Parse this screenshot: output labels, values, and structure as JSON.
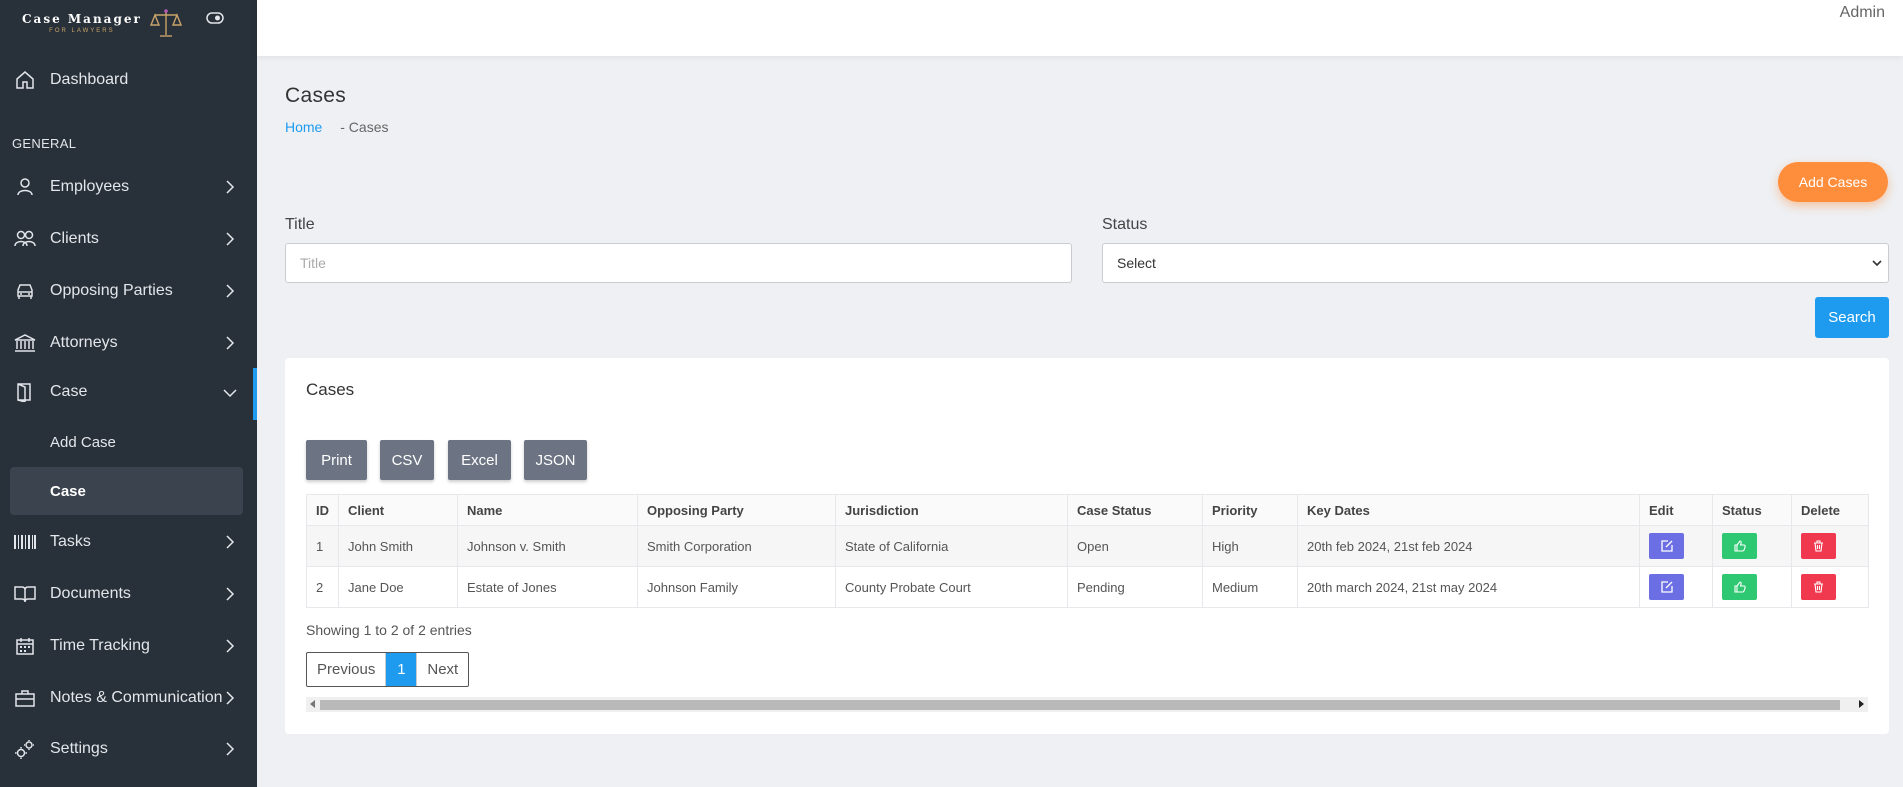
{
  "brand": {
    "title": "Case Manager",
    "subtitle": "FOR LAWYERS"
  },
  "header": {
    "user": "Admin"
  },
  "sidebar": {
    "dashboard": "Dashboard",
    "section": "GENERAL",
    "items": [
      {
        "label": "Employees"
      },
      {
        "label": "Clients"
      },
      {
        "label": "Opposing Parties"
      },
      {
        "label": "Attorneys"
      },
      {
        "label": "Case"
      },
      {
        "label": "Tasks"
      },
      {
        "label": "Documents"
      },
      {
        "label": "Time Tracking"
      },
      {
        "label": "Notes & Communication"
      },
      {
        "label": "Settings"
      }
    ],
    "case_sub": [
      {
        "label": "Add Case"
      },
      {
        "label": "Case"
      }
    ]
  },
  "page": {
    "title": "Cases",
    "breadcrumb_home": "Home",
    "breadcrumb_current": "- Cases",
    "add_button": "Add Cases"
  },
  "filters": {
    "title_label": "Title",
    "title_placeholder": "Title",
    "status_label": "Status",
    "status_value": "Select",
    "search_button": "Search"
  },
  "card": {
    "title": "Cases",
    "export_buttons": [
      "Print",
      "CSV",
      "Excel",
      "JSON"
    ],
    "columns": [
      "ID",
      "Client",
      "Name",
      "Opposing Party",
      "Jurisdiction",
      "Case Status",
      "Priority",
      "Key Dates",
      "Edit",
      "Status",
      "Delete"
    ],
    "rows": [
      {
        "id": "1",
        "client": "John Smith",
        "name": "Johnson v. Smith",
        "opposing": "Smith Corporation",
        "jurisdiction": "State of California",
        "status": "Open",
        "priority": "High",
        "dates": "20th feb 2024, 21st feb 2024"
      },
      {
        "id": "2",
        "client": "Jane Doe",
        "name": "Estate of Jones",
        "opposing": "Johnson Family",
        "jurisdiction": "County Probate Court",
        "status": "Pending",
        "priority": "Medium",
        "dates": "20th march 2024, 21st may 2024"
      }
    ],
    "showing": "Showing 1 to 2 of 2 entries",
    "pager": {
      "prev": "Previous",
      "current": "1",
      "next": "Next"
    }
  },
  "colors": {
    "sidebar": "#283039",
    "accent": "#1e9bef",
    "add": "#ff8e3c",
    "edit": "#6c6fe3",
    "status": "#2ec872",
    "delete": "#f0384f"
  }
}
